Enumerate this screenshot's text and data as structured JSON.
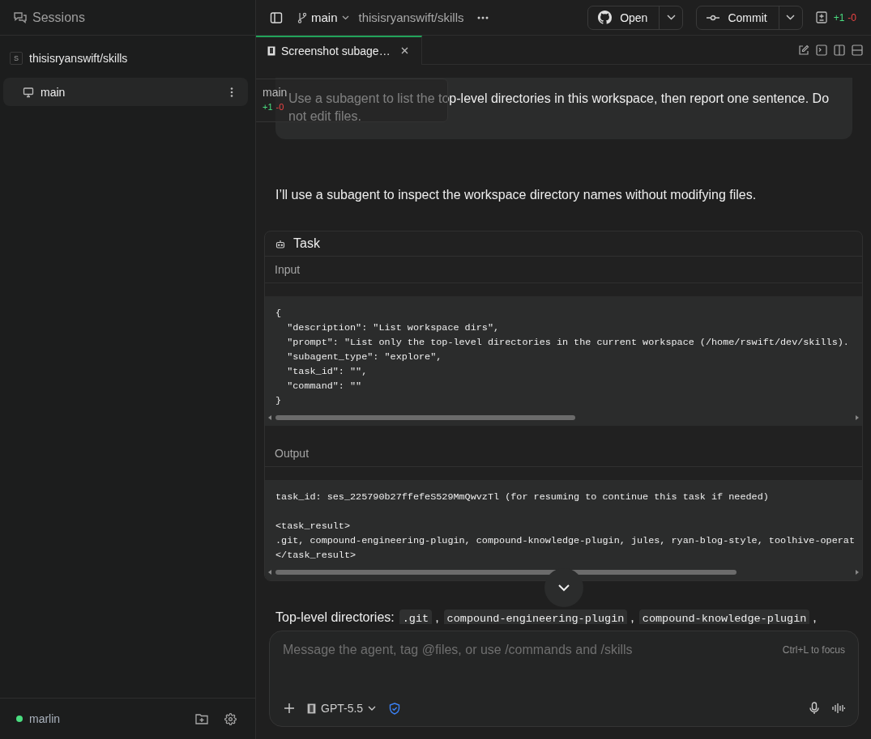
{
  "sidebar": {
    "title": "Sessions",
    "repos": [
      {
        "badge": "S",
        "name": "thisisryanswift/skills",
        "sessions": [
          {
            "name": "main",
            "selected": true
          }
        ]
      }
    ],
    "footer": {
      "name": "marlin",
      "color": "#4ade80"
    }
  },
  "toolbar": {
    "branch": "main",
    "repo": "thisisryanswift/skills",
    "open_button": "Open",
    "commit_button": "Commit",
    "diff": {
      "added": "+1",
      "removed": "-0"
    }
  },
  "tabs": [
    {
      "label": "Screenshot subage…",
      "selected": true
    }
  ],
  "tooltip": {
    "title": "main",
    "added": "+1",
    "removed": "-0"
  },
  "messages": [
    {
      "kind": "user",
      "text": "Use a subagent to list the top-level directories in this workspace, then report one sentence. Do not edit files."
    },
    {
      "kind": "assistant",
      "text": "I’ll use a subagent to inspect the workspace directory names without modifying files."
    },
    {
      "kind": "tool",
      "title": "Task",
      "sections": [
        {
          "label": "Input",
          "lines": [
            "{",
            "  \"description\": \"List workspace dirs\",",
            "  \"prompt\": \"List only the top-level directories in the current workspace (/home/rswift/dev/skills).",
            "  \"subagent_type\": \"explore\",",
            "  \"task_id\": \"\",",
            "  \"command\": \"\"",
            "}"
          ]
        },
        {
          "label": "Output",
          "lines": [
            "task_id: ses_225790b27ffefeS529MmQwvzTl (for resuming to continue this task if needed)"
          ]
        },
        {
          "lines": [
            "<task_result>",
            ".git, compound-engineering-plugin, compound-knowledge-plugin, jules, ryan-blog-style, toolhive-operat",
            "</task_result>"
          ]
        }
      ]
    },
    {
      "kind": "assistant_parts",
      "parts": [
        {
          "kind": "text",
          "text": "Top-level directories:"
        },
        {
          "kind": "code",
          "text": ".git"
        },
        {
          "kind": "text",
          "text": ","
        },
        {
          "kind": "code",
          "text": "compound-engineering-plugin"
        },
        {
          "kind": "text",
          "text": ","
        },
        {
          "kind": "code",
          "text": "compound-knowledge-plugin"
        },
        {
          "kind": "text",
          "text": ","
        }
      ]
    }
  ],
  "composer": {
    "placeholder": "Message the agent, tag @files, or use /commands and /skills",
    "hint": "Ctrl+L to focus",
    "model": "GPT-5.5"
  }
}
